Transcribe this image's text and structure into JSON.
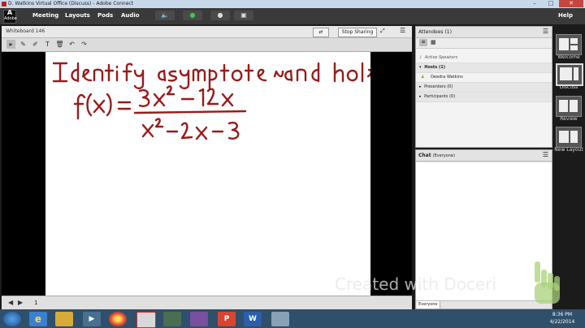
{
  "window": {
    "title": "D. Watkins Virtual Office (Discuss) - Adobe Connect",
    "minimize": "–",
    "maximize": "□",
    "close": "✕"
  },
  "menubar": {
    "logo_text": "Adobe",
    "items": [
      "Meeting",
      "Layouts",
      "Pods",
      "Audio"
    ],
    "help": "Help"
  },
  "whiteboard": {
    "title": "Whiteboard 146",
    "stop_sharing": "Stop Sharing",
    "page_number": "1",
    "menu_icon": "☰"
  },
  "attendees": {
    "title": "Attendees",
    "count": "(1)",
    "active_speakers": "Active Speakers",
    "groups": [
      {
        "label": "Hosts (1)",
        "members": [
          "Deedra Watkins"
        ]
      },
      {
        "label": "Presenters (0)",
        "members": []
      },
      {
        "label": "Participants (0)",
        "members": []
      }
    ]
  },
  "chat": {
    "title": "Chat",
    "audience": "(Everyone)",
    "tab": "Everyone"
  },
  "layouts": [
    {
      "label": "Welcome",
      "active": false
    },
    {
      "label": "Discuss",
      "active": true
    },
    {
      "label": "Review",
      "active": false
    },
    {
      "label": "New Layout",
      "active": false
    }
  ],
  "watermark": "Created with Doceri",
  "clock": {
    "time": "8:36 PM",
    "date": "4/22/2014"
  },
  "colors": {
    "accent": "#c7463f",
    "taskbar": "#2f4f6b",
    "ink": "#9a1a1a"
  }
}
